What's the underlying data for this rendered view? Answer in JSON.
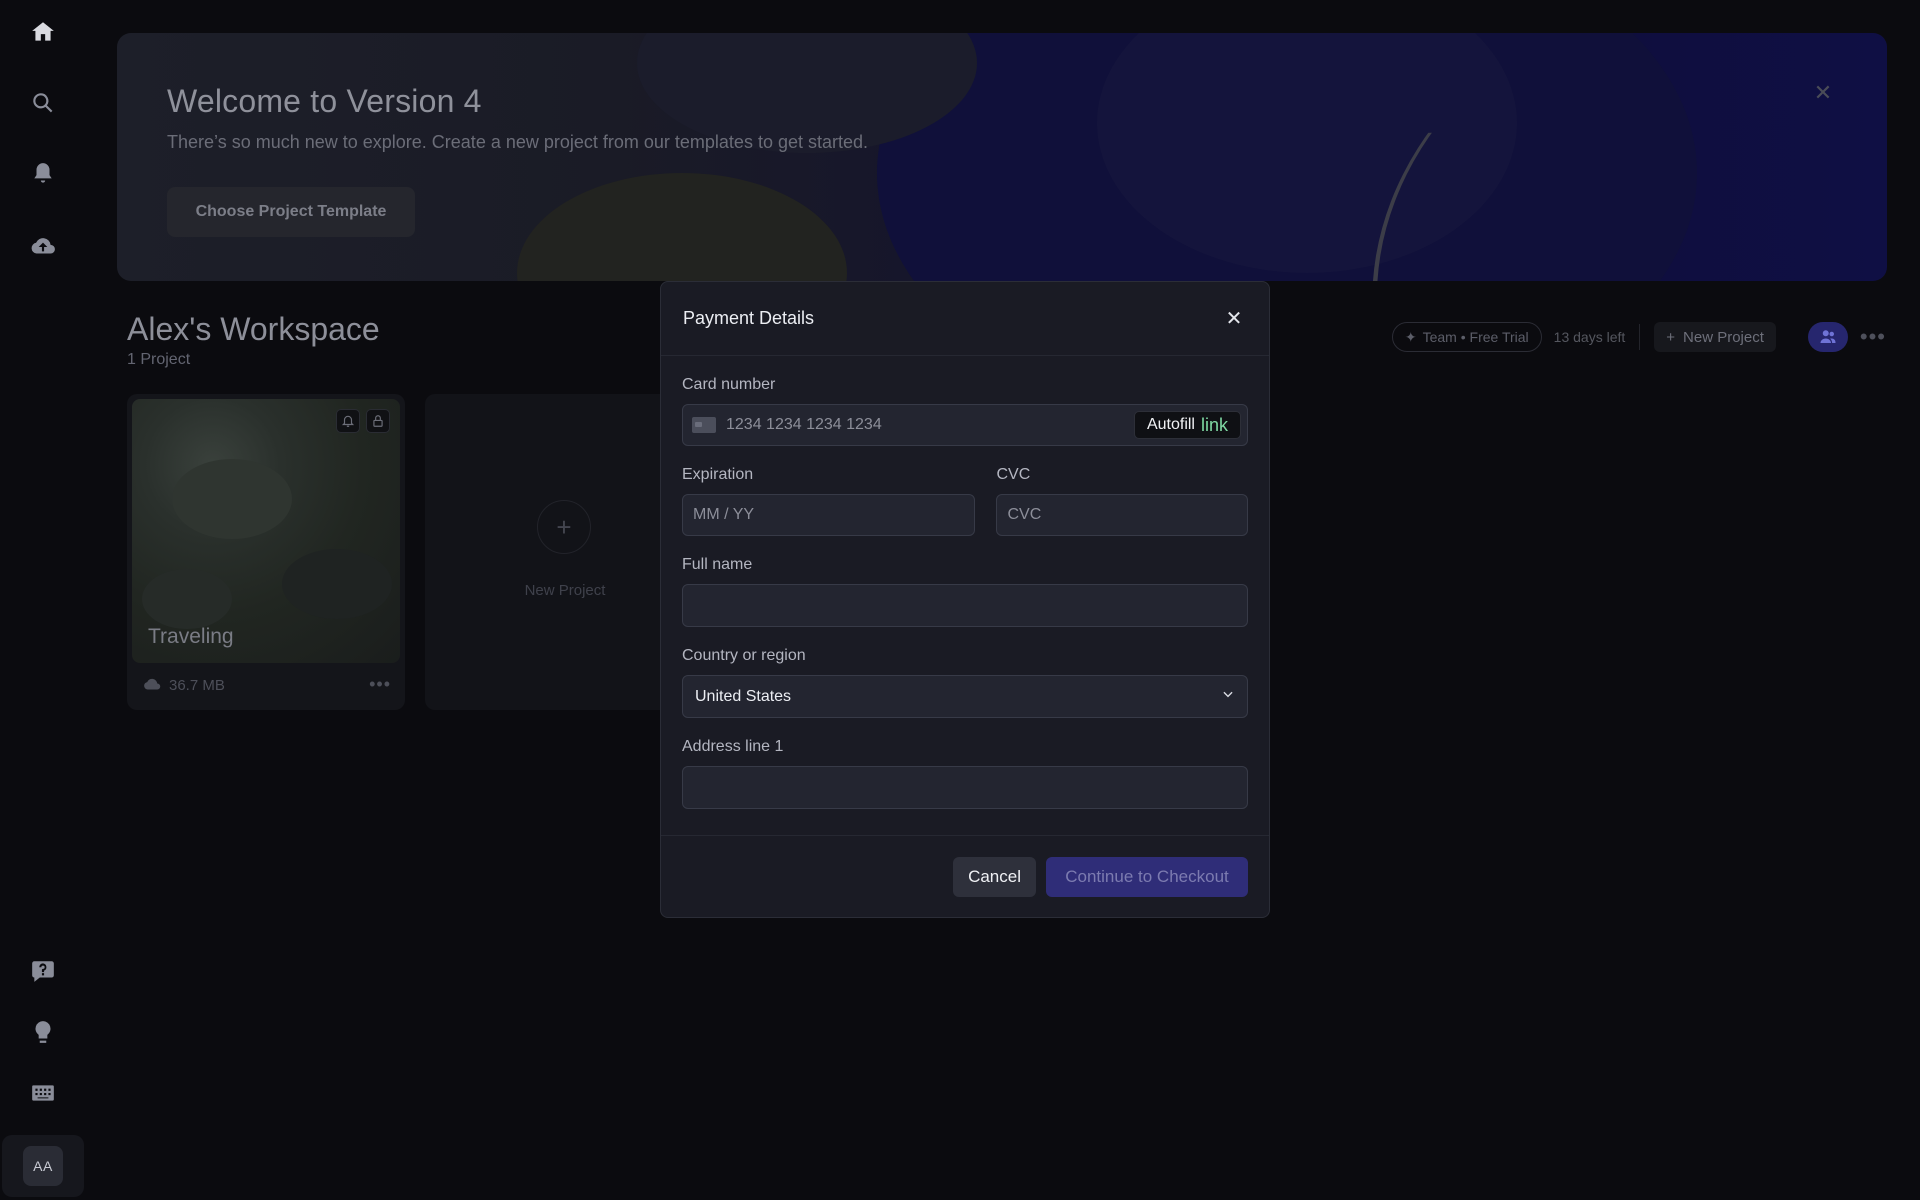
{
  "sidebar": {
    "icons": [
      "home-icon",
      "search-icon",
      "bell-icon",
      "cloud-upload-icon",
      "help-chat-icon",
      "lightbulb-icon",
      "keyboard-icon"
    ],
    "avatar_initials": "AA"
  },
  "hero": {
    "title": "Welcome to Version 4",
    "subtitle": "There’s so much new to explore. Create a new project from our templates to get started.",
    "button_label": "Choose Project Template"
  },
  "workspace": {
    "title": "Alex's Workspace",
    "project_count": "1 Project",
    "plan_label": "Team • Free Trial",
    "trial_remaining": "13 days left",
    "new_project_label": "New Project"
  },
  "projects": [
    {
      "name": "Traveling",
      "size": "36.7 MB"
    }
  ],
  "new_project_card": {
    "label": "New Project"
  },
  "modal": {
    "title": "Payment Details",
    "card_number": {
      "label": "Card number",
      "placeholder": "1234 1234 1234 1234",
      "autofill_label": "Autofill",
      "link_label": "link"
    },
    "expiration": {
      "label": "Expiration",
      "placeholder": "MM / YY"
    },
    "cvc": {
      "label": "CVC",
      "placeholder": "CVC"
    },
    "full_name": {
      "label": "Full name",
      "value": ""
    },
    "country": {
      "label": "Country or region",
      "value": "United States"
    },
    "address_line1": {
      "label": "Address line 1",
      "value": ""
    },
    "cancel_label": "Cancel",
    "continue_label": "Continue to Checkout"
  },
  "colors": {
    "accent": "#2f2d78",
    "link_green": "#7fd9a3",
    "modal_bg": "#1a1b24"
  }
}
